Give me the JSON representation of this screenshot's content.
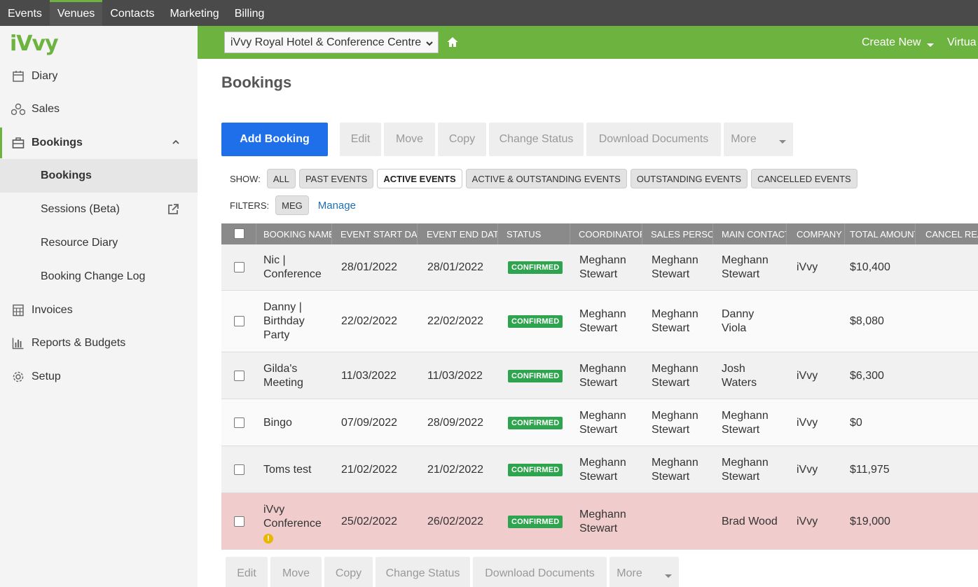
{
  "topnav": [
    "Events",
    "Venues",
    "Contacts",
    "Marketing",
    "Billing"
  ],
  "logo": "iVvy",
  "sidebar": {
    "items": [
      {
        "label": "Diary",
        "icon": "calendar-icon"
      },
      {
        "label": "Sales",
        "icon": "network-icon"
      },
      {
        "label": "Bookings",
        "icon": "briefcase-icon"
      },
      {
        "label": "Invoices",
        "icon": "calculator-icon"
      },
      {
        "label": "Reports & Budgets",
        "icon": "bar-chart-icon"
      },
      {
        "label": "Setup",
        "icon": "gear-icon"
      }
    ],
    "sub_items": [
      "Bookings",
      "Sessions (Beta)",
      "Resource Diary",
      "Booking Change Log"
    ]
  },
  "header": {
    "venue": "iVvy Royal Hotel & Conference Centre",
    "create_new": "Create New",
    "virtual": "Virtua"
  },
  "page_title": "Bookings",
  "toolbar": {
    "add": "Add Booking",
    "edit": "Edit",
    "move": "Move",
    "copy": "Copy",
    "change_status": "Change Status",
    "download": "Download Documents",
    "more": "More"
  },
  "show": {
    "label": "SHOW:",
    "options": [
      "ALL",
      "PAST EVENTS",
      "ACTIVE EVENTS",
      "ACTIVE & OUTSTANDING EVENTS",
      "OUTSTANDING EVENTS",
      "CANCELLED EVENTS"
    ],
    "active": "ACTIVE EVENTS"
  },
  "filters": {
    "label": "FILTERS:",
    "tag": "MEG",
    "manage": "Manage"
  },
  "table": {
    "columns": [
      "BOOKING NAME",
      "EVENT START DATE",
      "EVENT END DATE",
      "STATUS",
      "COORDINATOR",
      "SALES PERSON",
      "MAIN CONTACT",
      "COMPANY",
      "TOTAL AMOUNT",
      "CANCEL REAS"
    ],
    "rows": [
      {
        "name": [
          "Nic |",
          "Conference"
        ],
        "start": "28/01/2022",
        "end": "28/01/2022",
        "status": "CONFIRMED",
        "coordinator": [
          "Meghann",
          "Stewart"
        ],
        "sales": [
          "Meghann",
          "Stewart"
        ],
        "contact": [
          "Meghann",
          "Stewart"
        ],
        "company": "iVvy",
        "amount": "$10,400"
      },
      {
        "name": [
          "Danny |",
          "Birthday",
          "Party"
        ],
        "start": "22/02/2022",
        "end": "22/02/2022",
        "status": "CONFIRMED",
        "coordinator": [
          "Meghann",
          "Stewart"
        ],
        "sales": [
          "Meghann",
          "Stewart"
        ],
        "contact": [
          "Danny",
          "Viola"
        ],
        "company": "",
        "amount": "$8,080"
      },
      {
        "name": [
          "Gilda's",
          "Meeting"
        ],
        "start": "11/03/2022",
        "end": "11/03/2022",
        "status": "CONFIRMED",
        "coordinator": [
          "Meghann",
          "Stewart"
        ],
        "sales": [
          "Meghann",
          "Stewart"
        ],
        "contact": [
          "Josh",
          "Waters"
        ],
        "company": "iVvy",
        "amount": "$6,300"
      },
      {
        "name": [
          "Bingo"
        ],
        "start": "07/09/2022",
        "end": "28/09/2022",
        "status": "CONFIRMED",
        "coordinator": [
          "Meghann",
          "Stewart"
        ],
        "sales": [
          "Meghann",
          "Stewart"
        ],
        "contact": [
          "Meghann",
          "Stewart"
        ],
        "company": "iVvy",
        "amount": "$0"
      },
      {
        "name": [
          "Toms test"
        ],
        "start": "21/02/2022",
        "end": "21/02/2022",
        "status": "CONFIRMED",
        "coordinator": [
          "Meghann",
          "Stewart"
        ],
        "sales": [
          "Meghann",
          "Stewart"
        ],
        "contact": [
          "Meghann",
          "Stewart"
        ],
        "company": "iVvy",
        "amount": "$11,975"
      },
      {
        "name": [
          "iVvy",
          "Conference"
        ],
        "start": "25/02/2022",
        "end": "26/02/2022",
        "status": "CONFIRMED",
        "coordinator": [
          "Meghann",
          "Stewart"
        ],
        "sales": [],
        "contact": [
          "Brad Wood"
        ],
        "company": "iVvy",
        "amount": "$19,000",
        "warning": "!"
      }
    ]
  }
}
